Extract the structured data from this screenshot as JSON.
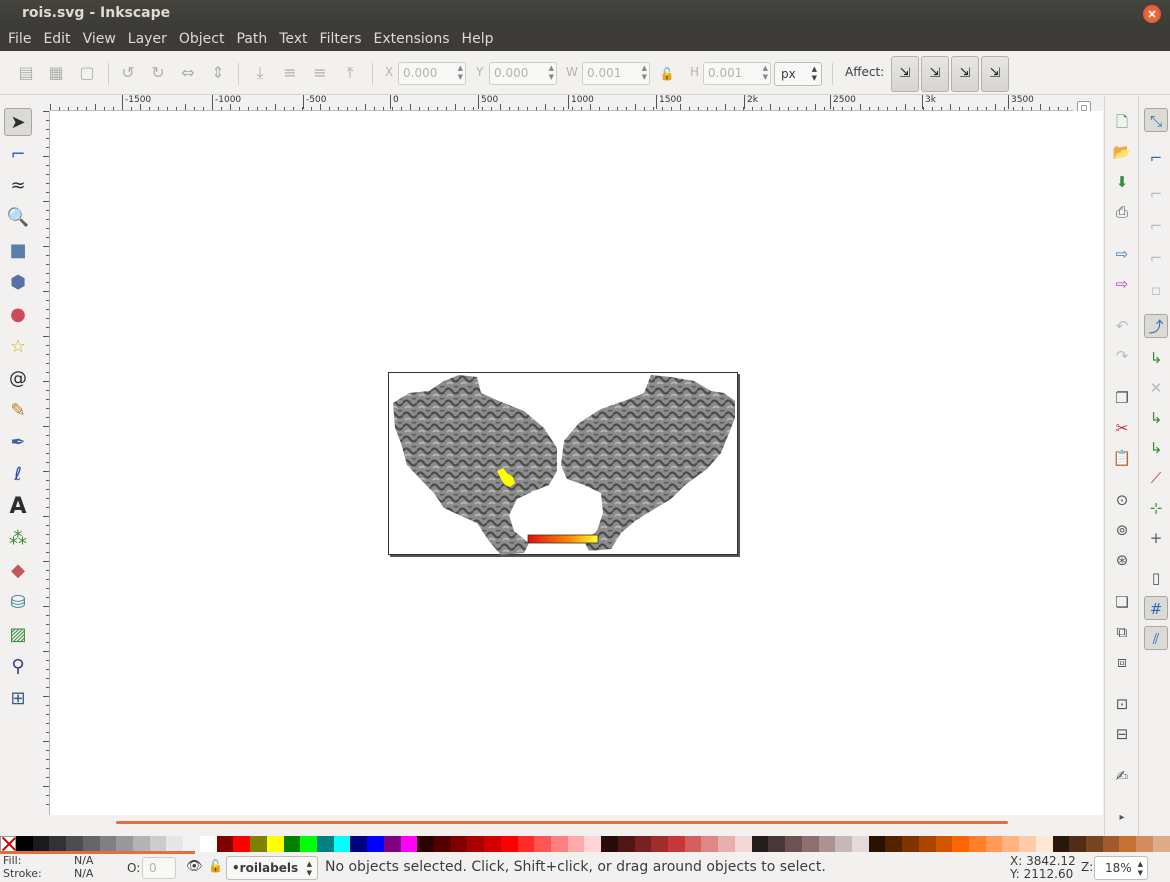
{
  "window": {
    "title": "rois.svg - Inkscape"
  },
  "menu": [
    "File",
    "Edit",
    "View",
    "Layer",
    "Object",
    "Path",
    "Text",
    "Filters",
    "Extensions",
    "Help"
  ],
  "toolbar": {
    "x_label": "X",
    "x_value": "0.000",
    "y_label": "Y",
    "y_value": "0.000",
    "w_label": "W",
    "w_value": "0.001",
    "h_label": "H",
    "h_value": "0.001",
    "unit": "px",
    "affect_label": "Affect:"
  },
  "ruler": {
    "h_labels": [
      "-1500",
      "-1000",
      "-500",
      "0",
      "500",
      "1000",
      "1500",
      "2k",
      "2500",
      "3k",
      "3500"
    ]
  },
  "palette_colors": [
    "#000000",
    "#1a1a1a",
    "#333333",
    "#4d4d4d",
    "#666666",
    "#808080",
    "#999999",
    "#b3b3b3",
    "#cccccc",
    "#e6e6e6",
    "#f2f2f2",
    "#ffffff",
    "#800000",
    "#ff0000",
    "#808000",
    "#ffff00",
    "#008000",
    "#00ff00",
    "#008080",
    "#00ffff",
    "#000080",
    "#0000ff",
    "#800080",
    "#ff00ff",
    "#2b0000",
    "#550000",
    "#800000",
    "#aa0000",
    "#d40000",
    "#ff0000",
    "#ff2a2a",
    "#ff5555",
    "#ff8080",
    "#ffaaaa",
    "#ffd5d5",
    "#280b0b",
    "#501616",
    "#782121",
    "#a02c2c",
    "#c83737",
    "#d35f5f",
    "#de8787",
    "#e9afaf",
    "#f4d7d7",
    "#241c1c",
    "#483737",
    "#6c5353",
    "#916f6f",
    "#ac9393",
    "#c8b7b7",
    "#e3dbdb",
    "#2b1100",
    "#552200",
    "#803300",
    "#aa4400",
    "#d45500",
    "#ff6600",
    "#ff7f2a",
    "#ff9955",
    "#ffb380",
    "#ffccaa",
    "#ffe6d5",
    "#28170b",
    "#502d16",
    "#784421",
    "#a05a2c",
    "#c87137",
    "#d38d5f",
    "#deaa87"
  ],
  "status": {
    "fill_label": "Fill:",
    "fill_value": "N/A",
    "stroke_label": "Stroke:",
    "stroke_value": "N/A",
    "opacity_label": "O:",
    "opacity_value": "0",
    "layer": "•roilabels",
    "message": "No objects selected. Click, Shift+click, or drag around objects to select.",
    "cursor_x": "X: 3842.12",
    "cursor_y": "Y: 2112.60",
    "zoom_label": "Z:",
    "zoom_value": "18%"
  },
  "colors": {
    "accent": "#e0703d",
    "titlebar": "#3c3b37",
    "close": "#de4b1b",
    "roi": "#ffff00"
  }
}
